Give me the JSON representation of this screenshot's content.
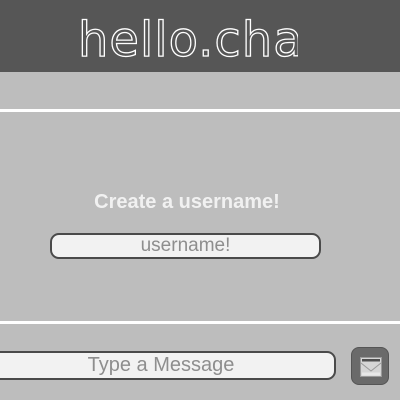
{
  "header": {
    "logo_text": "hello.chat"
  },
  "login": {
    "prompt": "Create a username!",
    "username_placeholder": "username!"
  },
  "composer": {
    "message_placeholder": "Type a Message",
    "send_icon": "envelope-icon"
  },
  "colors": {
    "header_bg": "#565656",
    "page_bg": "#bdbdbd",
    "divider": "#ffffff",
    "button_bg": "#6a6a6a"
  }
}
